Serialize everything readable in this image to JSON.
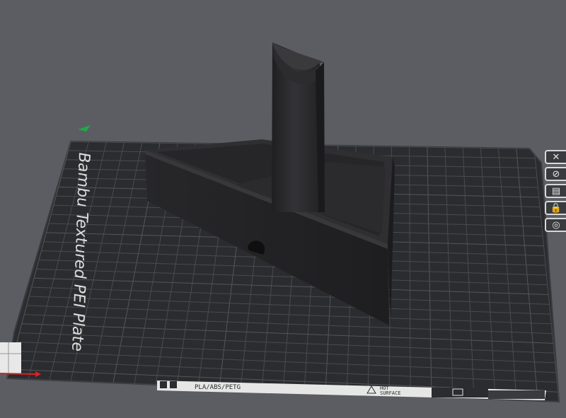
{
  "plate": {
    "name": "Bambu Textured PEI Plate",
    "material_label": "PLA/ABS/PETG",
    "hot_surface_line1": "HOT",
    "hot_surface_line2": "SURFACE"
  },
  "toolbar": {
    "icons": [
      "close-icon",
      "auto-orient-icon",
      "arrange-icon",
      "lock-icon",
      "settings-icon"
    ],
    "close_glyph": "✕",
    "orient_glyph": "⊘",
    "arrange_glyph": "▤",
    "lock_glyph": "🔒",
    "settings_glyph": "◎"
  },
  "colors": {
    "background": "#5c5d62",
    "plate": "#2b2c2f",
    "grid": "#4a4b50",
    "model": "#2a2a2c",
    "axis_x": "#e02020",
    "axis_y": "#1fa84a"
  }
}
